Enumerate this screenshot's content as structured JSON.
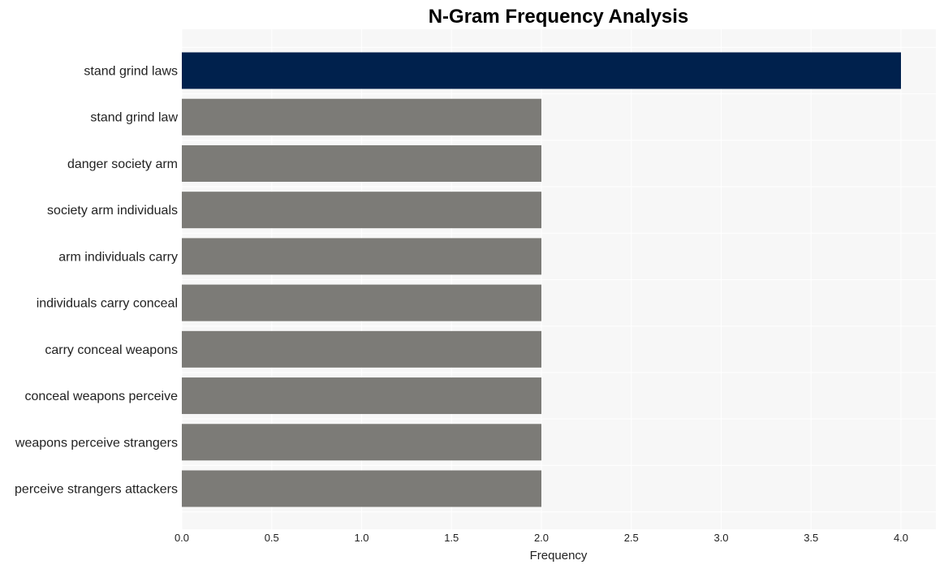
{
  "chart_data": {
    "type": "bar",
    "orientation": "horizontal",
    "title": "N-Gram Frequency Analysis",
    "xlabel": "Frequency",
    "ylabel": "",
    "categories": [
      "stand grind laws",
      "stand grind law",
      "danger society arm",
      "society arm individuals",
      "arm individuals carry",
      "individuals carry conceal",
      "carry conceal weapons",
      "conceal weapons perceive",
      "weapons perceive strangers",
      "perceive strangers attackers"
    ],
    "values": [
      4,
      2,
      2,
      2,
      2,
      2,
      2,
      2,
      2,
      2
    ],
    "xlim": [
      0,
      4.2
    ],
    "xticks": [
      "0.0",
      "0.5",
      "1.0",
      "1.5",
      "2.0",
      "2.5",
      "3.0",
      "3.5",
      "4.0"
    ],
    "grid": true,
    "legend": "none",
    "colors": {
      "highlight": "#00214d",
      "default": "#7c7b77",
      "plot_background": "#f7f7f7",
      "grid": "#ffffff"
    }
  }
}
